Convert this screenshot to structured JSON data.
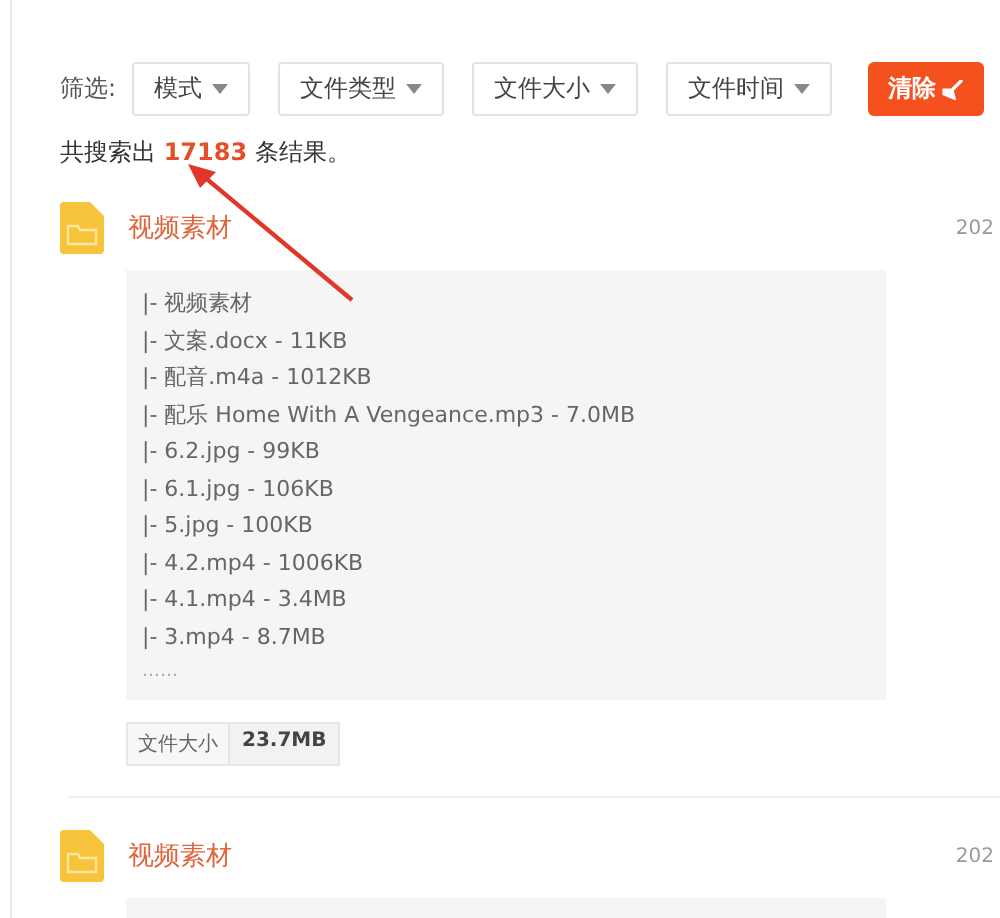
{
  "filter": {
    "label": "筛选:",
    "dropdowns": [
      "模式",
      "文件类型",
      "文件大小",
      "文件时间"
    ],
    "clear_button": "清除"
  },
  "result_count": {
    "prefix": "共搜索出",
    "number": "17183",
    "suffix": "条结果。"
  },
  "results": [
    {
      "title": "视频素材",
      "date": "202",
      "lines": [
        "|- 视频素材",
        "|- 文案.docx - 11KB",
        "|- 配音.m4a - 1012KB",
        "|- 配乐 Home With A Vengeance.mp3 - 7.0MB",
        "|- 6.2.jpg - 99KB",
        "|- 6.1.jpg - 106KB",
        "|- 5.jpg - 100KB",
        "|- 4.2.mp4 - 1006KB",
        "|- 4.1.mp4 - 3.4MB",
        "|- 3.mp4 - 8.7MB"
      ],
      "more": "……",
      "size_label": "文件大小",
      "size_value": "23.7MB"
    },
    {
      "title": "视频素材",
      "date": "202"
    }
  ]
}
